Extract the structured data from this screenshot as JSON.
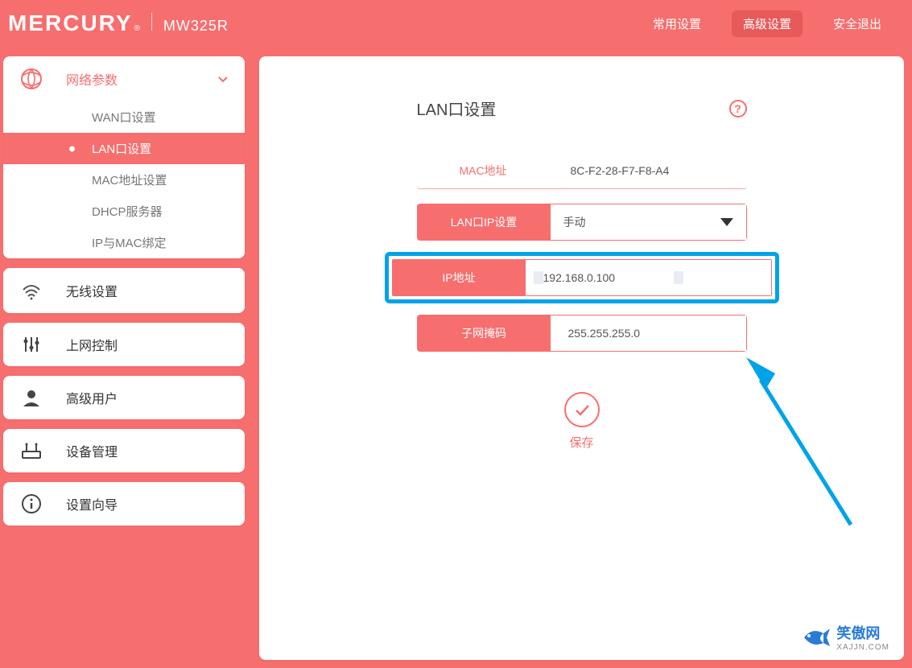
{
  "brand": {
    "name": "MERCURY",
    "reg": "®",
    "model": "MW325R"
  },
  "nav": {
    "common": "常用设置",
    "advanced": "高级设置",
    "logout": "安全退出"
  },
  "sidebar": {
    "network": {
      "label": "网络参数",
      "children": {
        "wan": "WAN口设置",
        "lan": "LAN口设置",
        "mac": "MAC地址设置",
        "dhcp": "DHCP服务器",
        "ipmac": "IP与MAC绑定"
      }
    },
    "wireless": {
      "label": "无线设置"
    },
    "accessctl": {
      "label": "上网控制"
    },
    "advuser": {
      "label": "高级用户"
    },
    "device": {
      "label": "设备管理"
    },
    "wizard": {
      "label": "设置向导"
    }
  },
  "page": {
    "title": "LAN口设置",
    "help": "?",
    "mac_label": "MAC地址",
    "mac_value": "8C-F2-28-F7-F8-A4",
    "lanip_label": "LAN口IP设置",
    "lanip_mode": "手动",
    "ip_label": "IP地址",
    "ip_value": "192.168.0.100",
    "netmask_label": "子网掩码",
    "netmask_value": "255.255.255.0",
    "save": "保存"
  },
  "watermark": {
    "text": "笑傲网",
    "sub": "XAJJN.COM"
  }
}
